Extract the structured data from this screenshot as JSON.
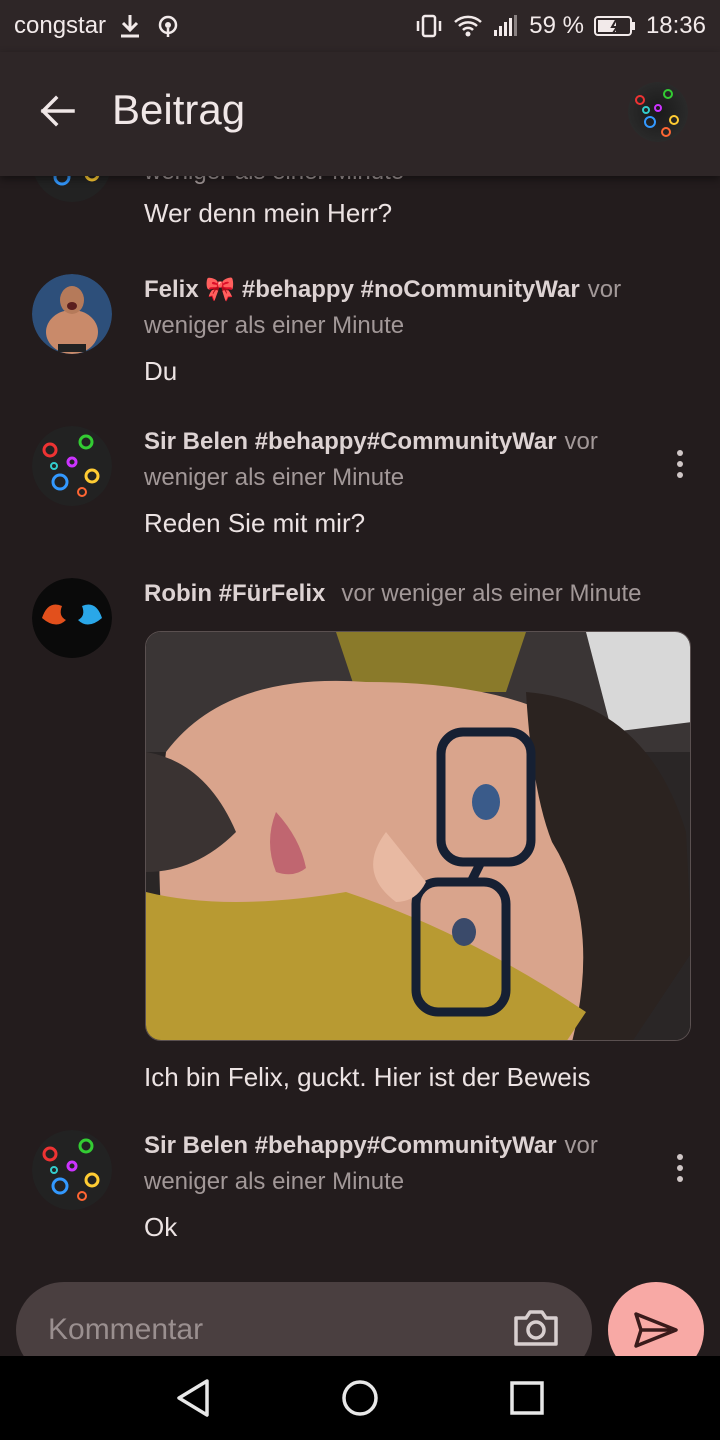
{
  "status_bar": {
    "carrier": "congstar",
    "battery": "59 %",
    "time": "18:36"
  },
  "app_bar": {
    "title": "Beitrag"
  },
  "comments": [
    {
      "author": "",
      "time": "weniger als einer Minute",
      "text": "Wer denn mein Herr?"
    },
    {
      "author": "Felix 🎀 #behappy #noCommunityWar",
      "time_prefix": "vor",
      "time": "weniger als einer Minute",
      "text": "Du"
    },
    {
      "author": "Sir Belen #behappy#CommunityWar",
      "time_prefix": "vor",
      "time": "weniger als einer Minute",
      "text": "Reden Sie mit mir?"
    },
    {
      "author": "Robin #FürFelix",
      "time": "vor weniger als einer Minute",
      "text": "Ich bin Felix, guckt. Hier ist der Beweis"
    },
    {
      "author": "Sir Belen #behappy#CommunityWar",
      "time_prefix": "vor",
      "time": "weniger als einer Minute",
      "text": "Ok"
    }
  ],
  "composer": {
    "placeholder": "Kommentar"
  },
  "colors": {
    "background": "#231c1d",
    "app_bar": "#2e2627",
    "input": "#4a3f40",
    "send_button": "#f8a9a5"
  },
  "icons": [
    "download-icon",
    "hotspot-icon",
    "vibrate-icon",
    "wifi-icon",
    "signal-icon",
    "battery-icon",
    "back-arrow-icon",
    "more-vert-icon",
    "camera-icon",
    "send-icon",
    "nav-back-icon",
    "nav-home-icon",
    "nav-recents-icon"
  ]
}
